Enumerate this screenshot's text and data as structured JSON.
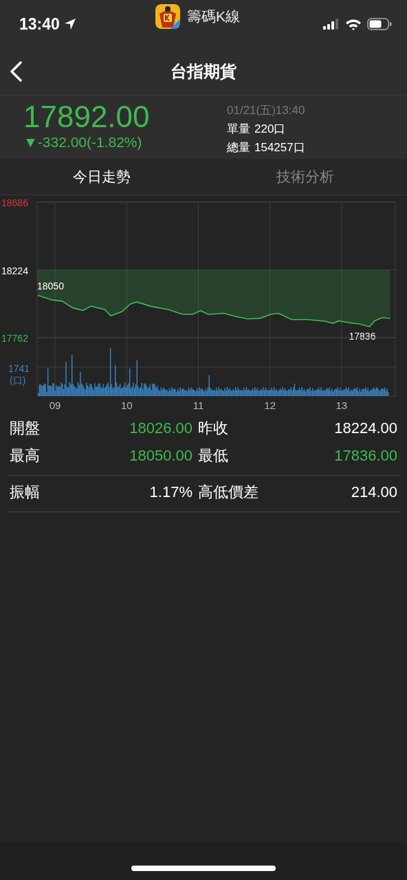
{
  "status_bar": {
    "time": "13:40",
    "app_name": "籌碼K線"
  },
  "nav": {
    "title": "台指期貨"
  },
  "quote": {
    "price": "17892.00",
    "change": "▼-332.00(-1.82%)",
    "color": "#3dbb4f",
    "timestamp": "01/21(五)13:40",
    "volumes": [
      {
        "label": "單量",
        "value": "220口"
      },
      {
        "label": "總量",
        "value": "154257口"
      }
    ]
  },
  "tabs": [
    {
      "label": "今日走勢",
      "selected": true
    },
    {
      "label": "技術分析",
      "selected": false
    }
  ],
  "chart": {
    "volume_label": "1741",
    "volume_unit": "(口)",
    "chart_data": {
      "type": "line",
      "xticks": [
        {
          "value": 9,
          "label": "09"
        },
        {
          "value": 10,
          "label": "10"
        },
        {
          "value": 11,
          "label": "11"
        },
        {
          "value": 12,
          "label": "12"
        },
        {
          "value": 13,
          "label": "13"
        }
      ],
      "yticks": [
        18686,
        18224,
        17762
      ],
      "ylim": [
        17762,
        18686
      ],
      "xlim": [
        8.75,
        13.75
      ],
      "x": [
        8.76,
        8.96,
        9.1,
        9.25,
        9.39,
        9.5,
        9.69,
        9.78,
        9.94,
        10.05,
        10.14,
        10.34,
        10.59,
        10.78,
        10.92,
        11.03,
        11.14,
        11.36,
        11.5,
        11.68,
        11.86,
        12.01,
        12.12,
        12.3,
        12.52,
        12.77,
        12.88,
        12.96,
        13.1,
        13.25,
        13.39,
        13.46,
        13.57,
        13.68
      ],
      "grid": true,
      "series": [
        {
          "color": "#3dbb4f",
          "values": [
            18050,
            18018,
            18010,
            17964,
            17947,
            17976,
            17955,
            17911,
            17940,
            17991,
            18005,
            17975,
            17952,
            17920,
            17920,
            17945,
            17920,
            17927,
            17909,
            17890,
            17893,
            17920,
            17927,
            17885,
            17885,
            17873,
            17859,
            17876,
            17864,
            17855,
            17836,
            17876,
            17898,
            17892
          ]
        }
      ],
      "annotations": [
        {
          "text": "18050",
          "x": 8.76,
          "y": 18050
        },
        {
          "text": "17836",
          "x": 13.39,
          "y": 17836
        }
      ]
    }
  },
  "stat_groups": [
    [
      {
        "label": "開盤",
        "value": "18026.00",
        "color": "#3dbb4f"
      },
      {
        "label": "昨收",
        "value": "18224.00",
        "color": "#ffffff"
      },
      {
        "label": "最高",
        "value": "18050.00",
        "color": "#3dbb4f"
      },
      {
        "label": "最低",
        "value": "17836.00",
        "color": "#3dbb4f"
      }
    ],
    [
      {
        "label": "振幅",
        "value": "1.17%",
        "color": "#ffffff"
      },
      {
        "label": "高低價差",
        "value": "214.00",
        "color": "#ffffff"
      }
    ]
  ]
}
